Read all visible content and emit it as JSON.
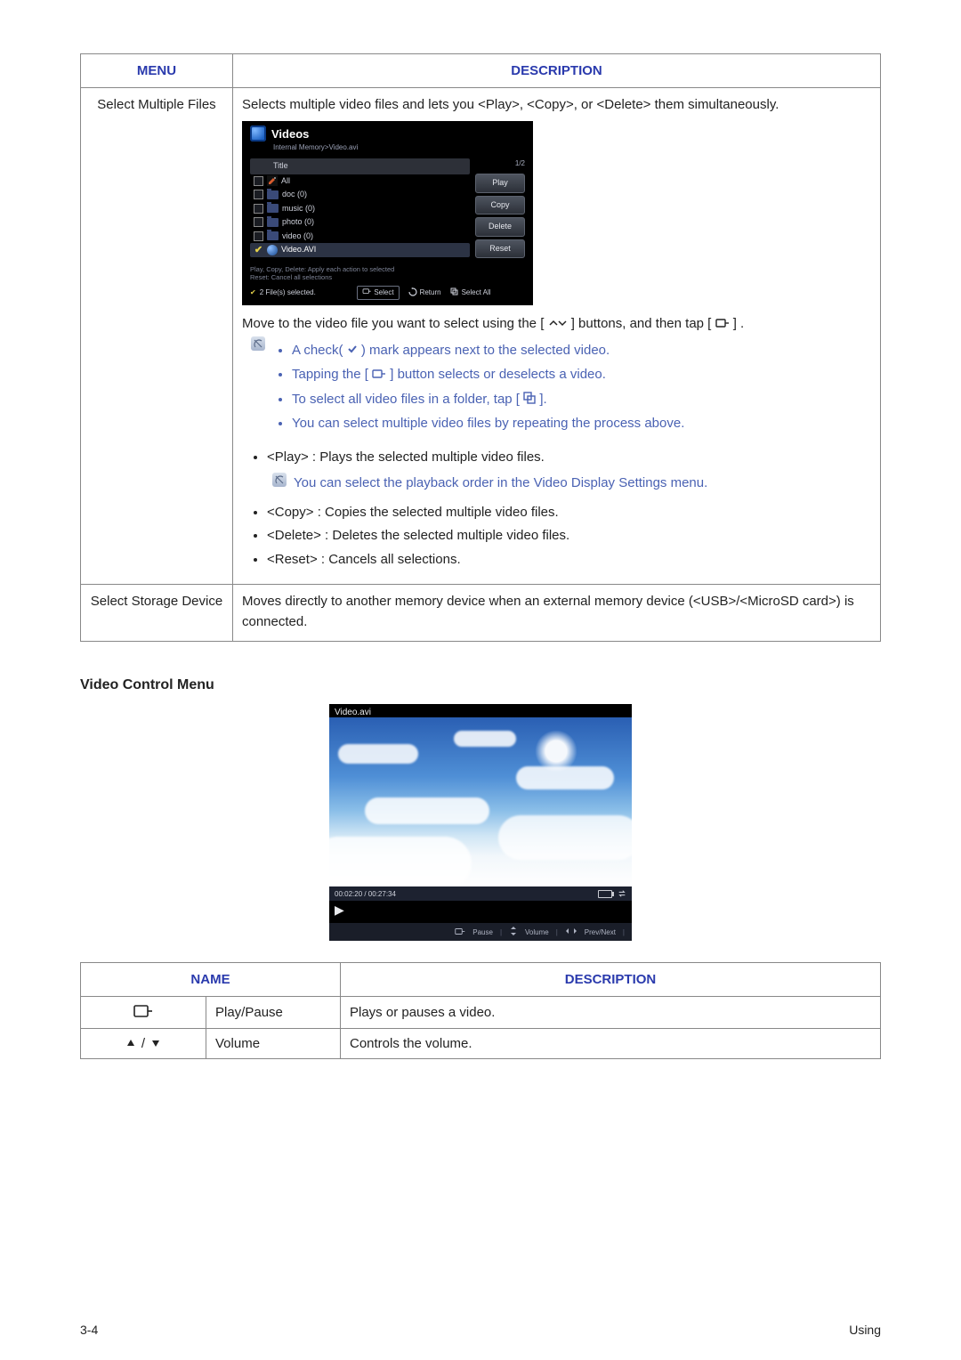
{
  "headings": {
    "menu_col": "MENU",
    "description_col": "DESCRIPTION",
    "video_control": "Video Control Menu",
    "name_col": "NAME"
  },
  "row1": {
    "menu": "Select Multiple Files",
    "intro": "Selects multiple video files and lets you <Play>, <Copy>, or <Delete> them simultaneously.",
    "move_line_a": "Move to the video file you want to select using the [",
    "move_line_b": "] buttons, and then tap [",
    "move_line_c": "] .",
    "tip1_a": "A check(",
    "tip1_b": ") mark appears next to the selected video.",
    "tip2_a": "Tapping the [",
    "tip2_b": "] button selects or deselects a video.",
    "tip3_a": "To select all video files in a folder, tap [",
    "tip3_b": "].",
    "tip4": "You can select multiple video files by repeating the process above.",
    "b_play": "<Play> : Plays the selected multiple video files.",
    "play_note": "You can select the playback order in the Video Display Settings menu.",
    "b_copy": "<Copy> : Copies the selected multiple video files.",
    "b_delete": "<Delete> : Deletes the selected multiple video files.",
    "b_reset": "<Reset> : Cancels all selections."
  },
  "row2": {
    "menu": "Select Storage Device",
    "desc": "Moves directly to another memory device when an external memory device (<USB>/<MicroSD card>) is connected."
  },
  "device": {
    "title": "Videos",
    "breadcrumb": "Internal Memory>Video.avi",
    "hdr_title": "Title",
    "page": "1/2",
    "rows": {
      "all": "All",
      "doc": "doc (0)",
      "music": "music (0)",
      "photo": "photo (0)",
      "video": "video (0)",
      "sel": "Video.AVI"
    },
    "side": {
      "play": "Play",
      "copy": "Copy",
      "delete": "Delete",
      "reset": "Reset"
    },
    "hint1": "Play, Copy, Delete: Apply each action to selected",
    "hint2": "Reset: Cancel all selections",
    "status": {
      "count": "2 File(s) selected.",
      "select": "Select",
      "return": "Return",
      "selectall": "Select All"
    }
  },
  "player": {
    "file": "Video.avi",
    "time": "00:02:20 / 00:27:34",
    "hints": {
      "pause": "Pause",
      "volume": "Volume",
      "prevnext": "Prev/Next"
    }
  },
  "ctrl": {
    "r1_name": "Play/Pause",
    "r1_desc": "Plays or pauses a video.",
    "r2_name": "Volume",
    "r2_desc": "Controls the volume."
  },
  "footer": {
    "left": "3-4",
    "right": "Using"
  }
}
